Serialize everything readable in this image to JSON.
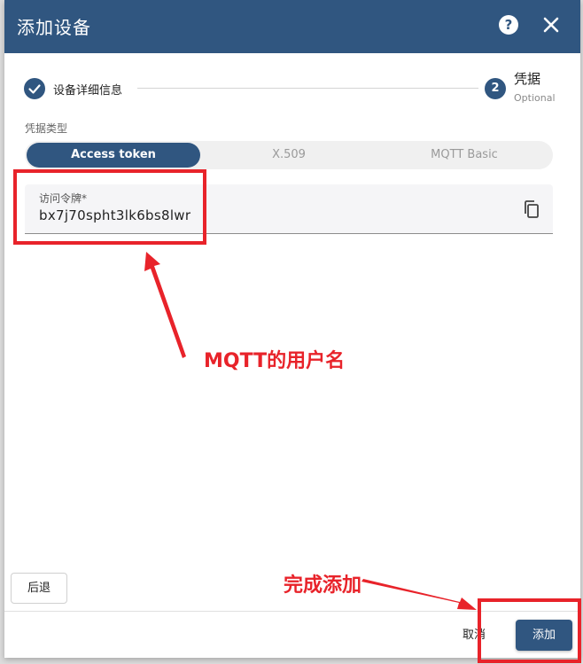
{
  "dialog": {
    "title": "添加设备",
    "help_glyph": "?"
  },
  "stepper": {
    "step1_label": "设备详细信息",
    "step2_number": "2",
    "step2_label": "凭据",
    "step2_optional": "Optional"
  },
  "credentials": {
    "type_label": "凭据类型",
    "options": [
      "Access token",
      "X.509",
      "MQTT Basic"
    ],
    "selected": "Access token",
    "field_label": "访问令牌*",
    "field_value": "bx7j70spht3lk6bs8lwr"
  },
  "footer": {
    "back_label": "后退",
    "cancel_label": "取消",
    "add_label": "添加"
  },
  "annotations": {
    "mqtt_username": "MQTT的用户名",
    "finish_add": "完成添加"
  },
  "colors": {
    "primary": "#305680",
    "annotation_red": "#e8232a"
  }
}
